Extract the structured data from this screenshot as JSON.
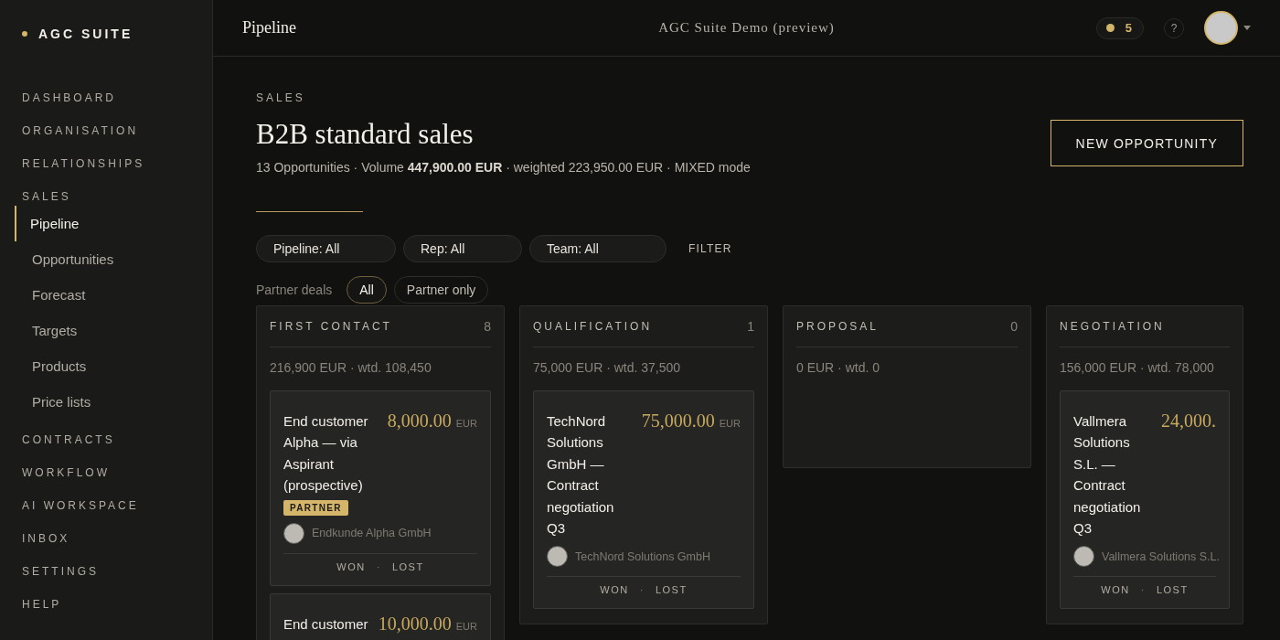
{
  "sidebar": {
    "brand": "AGC SUITE",
    "items": [
      {
        "label": "DASHBOARD",
        "selected": false
      },
      {
        "label": "ORGANISATION",
        "selected": false
      },
      {
        "label": "RELATIONSHIPS",
        "selected": false
      },
      {
        "label": "SALES",
        "selected": false,
        "expanded": true,
        "children": [
          {
            "label": "Pipeline",
            "selected": true
          },
          {
            "label": "Opportunities",
            "selected": false
          },
          {
            "label": "Forecast",
            "selected": false
          },
          {
            "label": "Targets",
            "selected": false
          },
          {
            "label": "Products",
            "selected": false
          },
          {
            "label": "Price lists",
            "selected": false
          }
        ]
      },
      {
        "label": "CONTRACTS",
        "selected": false
      },
      {
        "label": "WORKFLOW",
        "selected": false
      },
      {
        "label": "AI WORKSPACE",
        "selected": false
      },
      {
        "label": "INBOX",
        "selected": false
      },
      {
        "label": "SETTINGS",
        "selected": false
      },
      {
        "label": "HELP",
        "selected": false
      }
    ]
  },
  "header": {
    "title": "Pipeline",
    "subtitle": "AGC Suite Demo (preview)",
    "notifications": "5",
    "help": "?"
  },
  "page": {
    "eyebrow": "SALES",
    "title": "B2B standard sales",
    "summary": "13 Opportunities · Volume **447,900.00 EUR** · weighted 223,950.00 EUR · MIXED mode",
    "primary_button": "NEW OPPORTUNITY"
  },
  "filters": {
    "selects": [
      {
        "value": "Pipeline: All"
      },
      {
        "value": "Rep: All"
      },
      {
        "value": "Team: All"
      }
    ],
    "filter_button": "FILTER",
    "partner_label": "Partner deals",
    "partner_options": [
      {
        "label": "All",
        "selected": true
      },
      {
        "label": "Partner only",
        "selected": false
      }
    ]
  },
  "board": {
    "columns": [
      {
        "title": "FIRST CONTACT",
        "count": "8",
        "totals": "216,900 EUR · wtd. 108,450",
        "cards": [
          {
            "title": "End customer Alpha — via Aspirant (prospective)",
            "amount": "8,000.00",
            "currency": "EUR",
            "badge": "PARTNER",
            "account": "Endkunde Alpha GmbH",
            "won": "WON",
            "separator": "·",
            "lost": "LOST"
          },
          {
            "title": "End customer",
            "amount": "10,000.00",
            "currency": "EUR"
          }
        ]
      },
      {
        "title": "QUALIFICATION",
        "count": "1",
        "totals": "75,000 EUR · wtd. 37,500",
        "cards": [
          {
            "title": "TechNord Solutions GmbH — Contract negotiation Q3",
            "amount": "75,000.00",
            "currency": "EUR",
            "account": "TechNord Solutions GmbH",
            "won": "WON",
            "separator": "·",
            "lost": "LOST"
          }
        ]
      },
      {
        "title": "PROPOSAL",
        "count": "0",
        "totals": "0 EUR · wtd. 0"
      },
      {
        "title": "NEGOTIATION",
        "totals": "156,000 EUR · wtd. 78,000",
        "cards": [
          {
            "title": "Vallmera Solutions S.L. — Contract negotiation Q3",
            "amount": "24,000.",
            "account": "Vallmera Solutions S.L.",
            "won": "WON",
            "separator": "·",
            "lost": "LOST"
          }
        ]
      }
    ]
  }
}
